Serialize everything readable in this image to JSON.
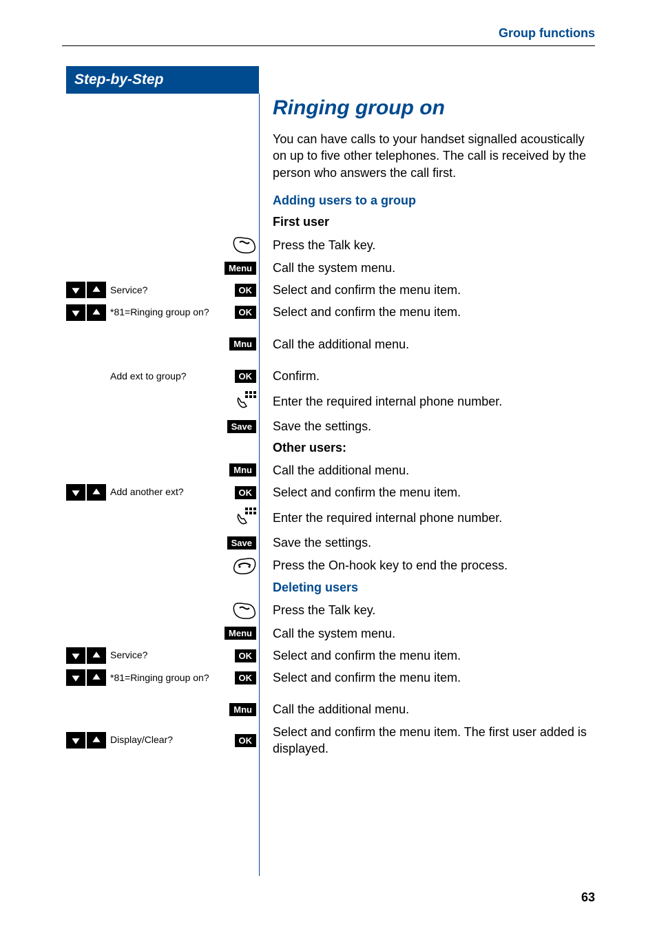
{
  "header": {
    "section": "Group functions"
  },
  "sidebar": {
    "title": "Step-by-Step"
  },
  "title": "Ringing group on",
  "intro": "You can have calls to your handset signalled acoustically on up to five other telephones. The call is received by the person who answers the call first.",
  "sections": {
    "adding": "Adding users to a group",
    "firstuser": "First user",
    "otherusers": "Other users:",
    "deleting": "Deleting users"
  },
  "badges": {
    "menu": "Menu",
    "ok": "OK",
    "mnu": "Mnu",
    "save": "Save"
  },
  "display": {
    "service": "Service?",
    "ringing": "*81=Ringing group on?",
    "addext": "Add ext to group?",
    "addanother": "Add another ext?",
    "displayclear": "Display/Clear?"
  },
  "text": {
    "talk": "Press the Talk key.",
    "sysmenu": "Call the system menu.",
    "selconfirm": "Select and confirm the menu item.",
    "addmenu": "Call the additional menu.",
    "confirm": "Confirm.",
    "enternum": "Enter the required internal phone number.",
    "save": "Save the settings.",
    "onhook": "Press the On-hook key to end the process.",
    "selconfirmfirst": "Select and confirm the menu item. The first user added is displayed."
  },
  "pagenum": "63"
}
